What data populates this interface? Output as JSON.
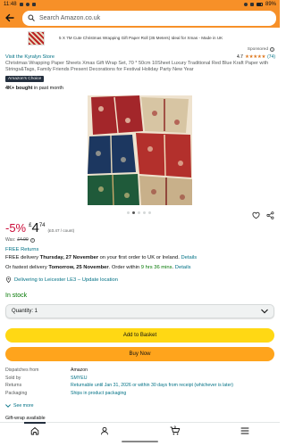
{
  "status_bar": {
    "time": "11:48",
    "battery": "89%"
  },
  "header": {
    "search_placeholder": "Search Amazon.co.uk"
  },
  "ad_banner": {
    "text": "5 X 7M Cute Christmas Wrapping Gift Paper Roll (35 Meters) Ideal for Xmas - Made in UK",
    "sponsored": "Sponsored"
  },
  "product": {
    "store_link": "Visit the Kyralyn Store",
    "rating_value": "4.7",
    "rating_stars": "★★★★★",
    "rating_count": "(74)",
    "title": "Christmas Wrapping Paper Sheets Xmas Gift Wrap Set, 70 * 50cm 10Sheet Luxury Traditional Red Blue Kraft Paper with Strings&Tags, Family Friends Present Decorations for Festival Holiday Party New Year",
    "badge": "Amazon's Choice",
    "bought_bold": "4K+ bought",
    "bought_rest": " in past month",
    "image_count": 5,
    "image_active_index": 1
  },
  "price": {
    "discount": "-5%",
    "currency": "£",
    "whole": "4",
    "fraction": "74",
    "unit_price": "(£0.47 / count)",
    "was_label": "Was:",
    "was_value": "£4.99"
  },
  "delivery": {
    "free_returns": "FREE Returns",
    "free_delivery_prefix": "FREE delivery ",
    "free_delivery_date": "Thursday, 27 November",
    "free_delivery_suffix": " on your first order to UK or Ireland. ",
    "details_link": "Details",
    "fastest_prefix": "Or fastest delivery ",
    "fastest_date": "Tomorrow, 25 November",
    "fastest_mid": ". Order within ",
    "fastest_countdown": "9 hrs 36 mins",
    "fastest_end": ". ",
    "location": "Delivering to Leicester LE3 – Update location"
  },
  "stock": {
    "status": "In stock",
    "quantity_label": "Quantity: 1"
  },
  "buttons": {
    "add_to_basket": "Add to Basket",
    "buy_now": "Buy Now"
  },
  "details": [
    {
      "key": "Dispatches from",
      "value": "Amazon",
      "link": false
    },
    {
      "key": "Sold by",
      "value": "SMYEU",
      "link": true
    },
    {
      "key": "Returns",
      "value": "Returnable until Jan 31, 2026 or within 30 days from receipt (whichever is later)",
      "link": true
    },
    {
      "key": "Packaging",
      "value": "Ships in product packaging",
      "link": true
    }
  ],
  "see_more": "See more",
  "gift_wrap": "Gift-wrap available",
  "nav": {
    "cart_count": "0"
  },
  "colors": {
    "header": "#f79028",
    "add_to_basket": "#ffd814",
    "buy_now": "#ffa41c",
    "link": "#007185",
    "in_stock": "#007600",
    "discount": "#cc0c39"
  }
}
